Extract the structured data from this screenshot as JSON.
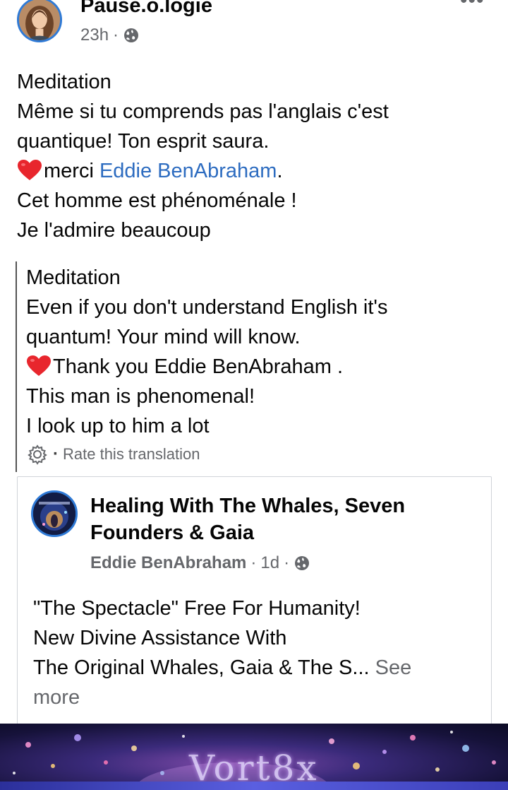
{
  "post": {
    "author": "Pause.o.logie",
    "time": "23h",
    "meta_sep": "·",
    "menu_glyph": "•••",
    "text_lines": [
      "Meditation",
      "Même si tu comprends pas l'anglais c'est",
      "quantique! Ton esprit saura.",
      "Cet homme est phénoménale !",
      "Je l'admire beaucoup"
    ],
    "thanks_prefix": "merci ",
    "mention": "Eddie BenAbraham",
    "thanks_suffix": "."
  },
  "translation": {
    "lines": [
      "Meditation",
      "Even if you don't understand English it's",
      "quantum! Your mind will know.",
      "Thank you Eddie BenAbraham .",
      "This man is phenomenal!",
      "I look up to him a lot"
    ],
    "rate_sep": "·",
    "rate_label": "Rate this translation"
  },
  "shared": {
    "title_lines": [
      "Healing With The Whales, Seven",
      "Founders & Gaia"
    ],
    "sub_author": "Eddie BenAbraham",
    "meta_sep": "·",
    "time": "1d",
    "body_lines": [
      "\"The Spectacle\" Free For Humanity!",
      "New Divine Assistance With",
      "The Original Whales, Gaia & The S..."
    ],
    "see_more_1": " See",
    "see_more_2": "more",
    "media_title": "Vort8x"
  },
  "colors": {
    "link_blue": "#2d6cc0",
    "meta_grey": "#65676b",
    "heart_red": "#e8262d",
    "ring_blue": "#2f7ad6"
  },
  "icons": {
    "audience": "globe-icon",
    "rate": "gear-icon",
    "heart": "red-heart-emoji"
  }
}
